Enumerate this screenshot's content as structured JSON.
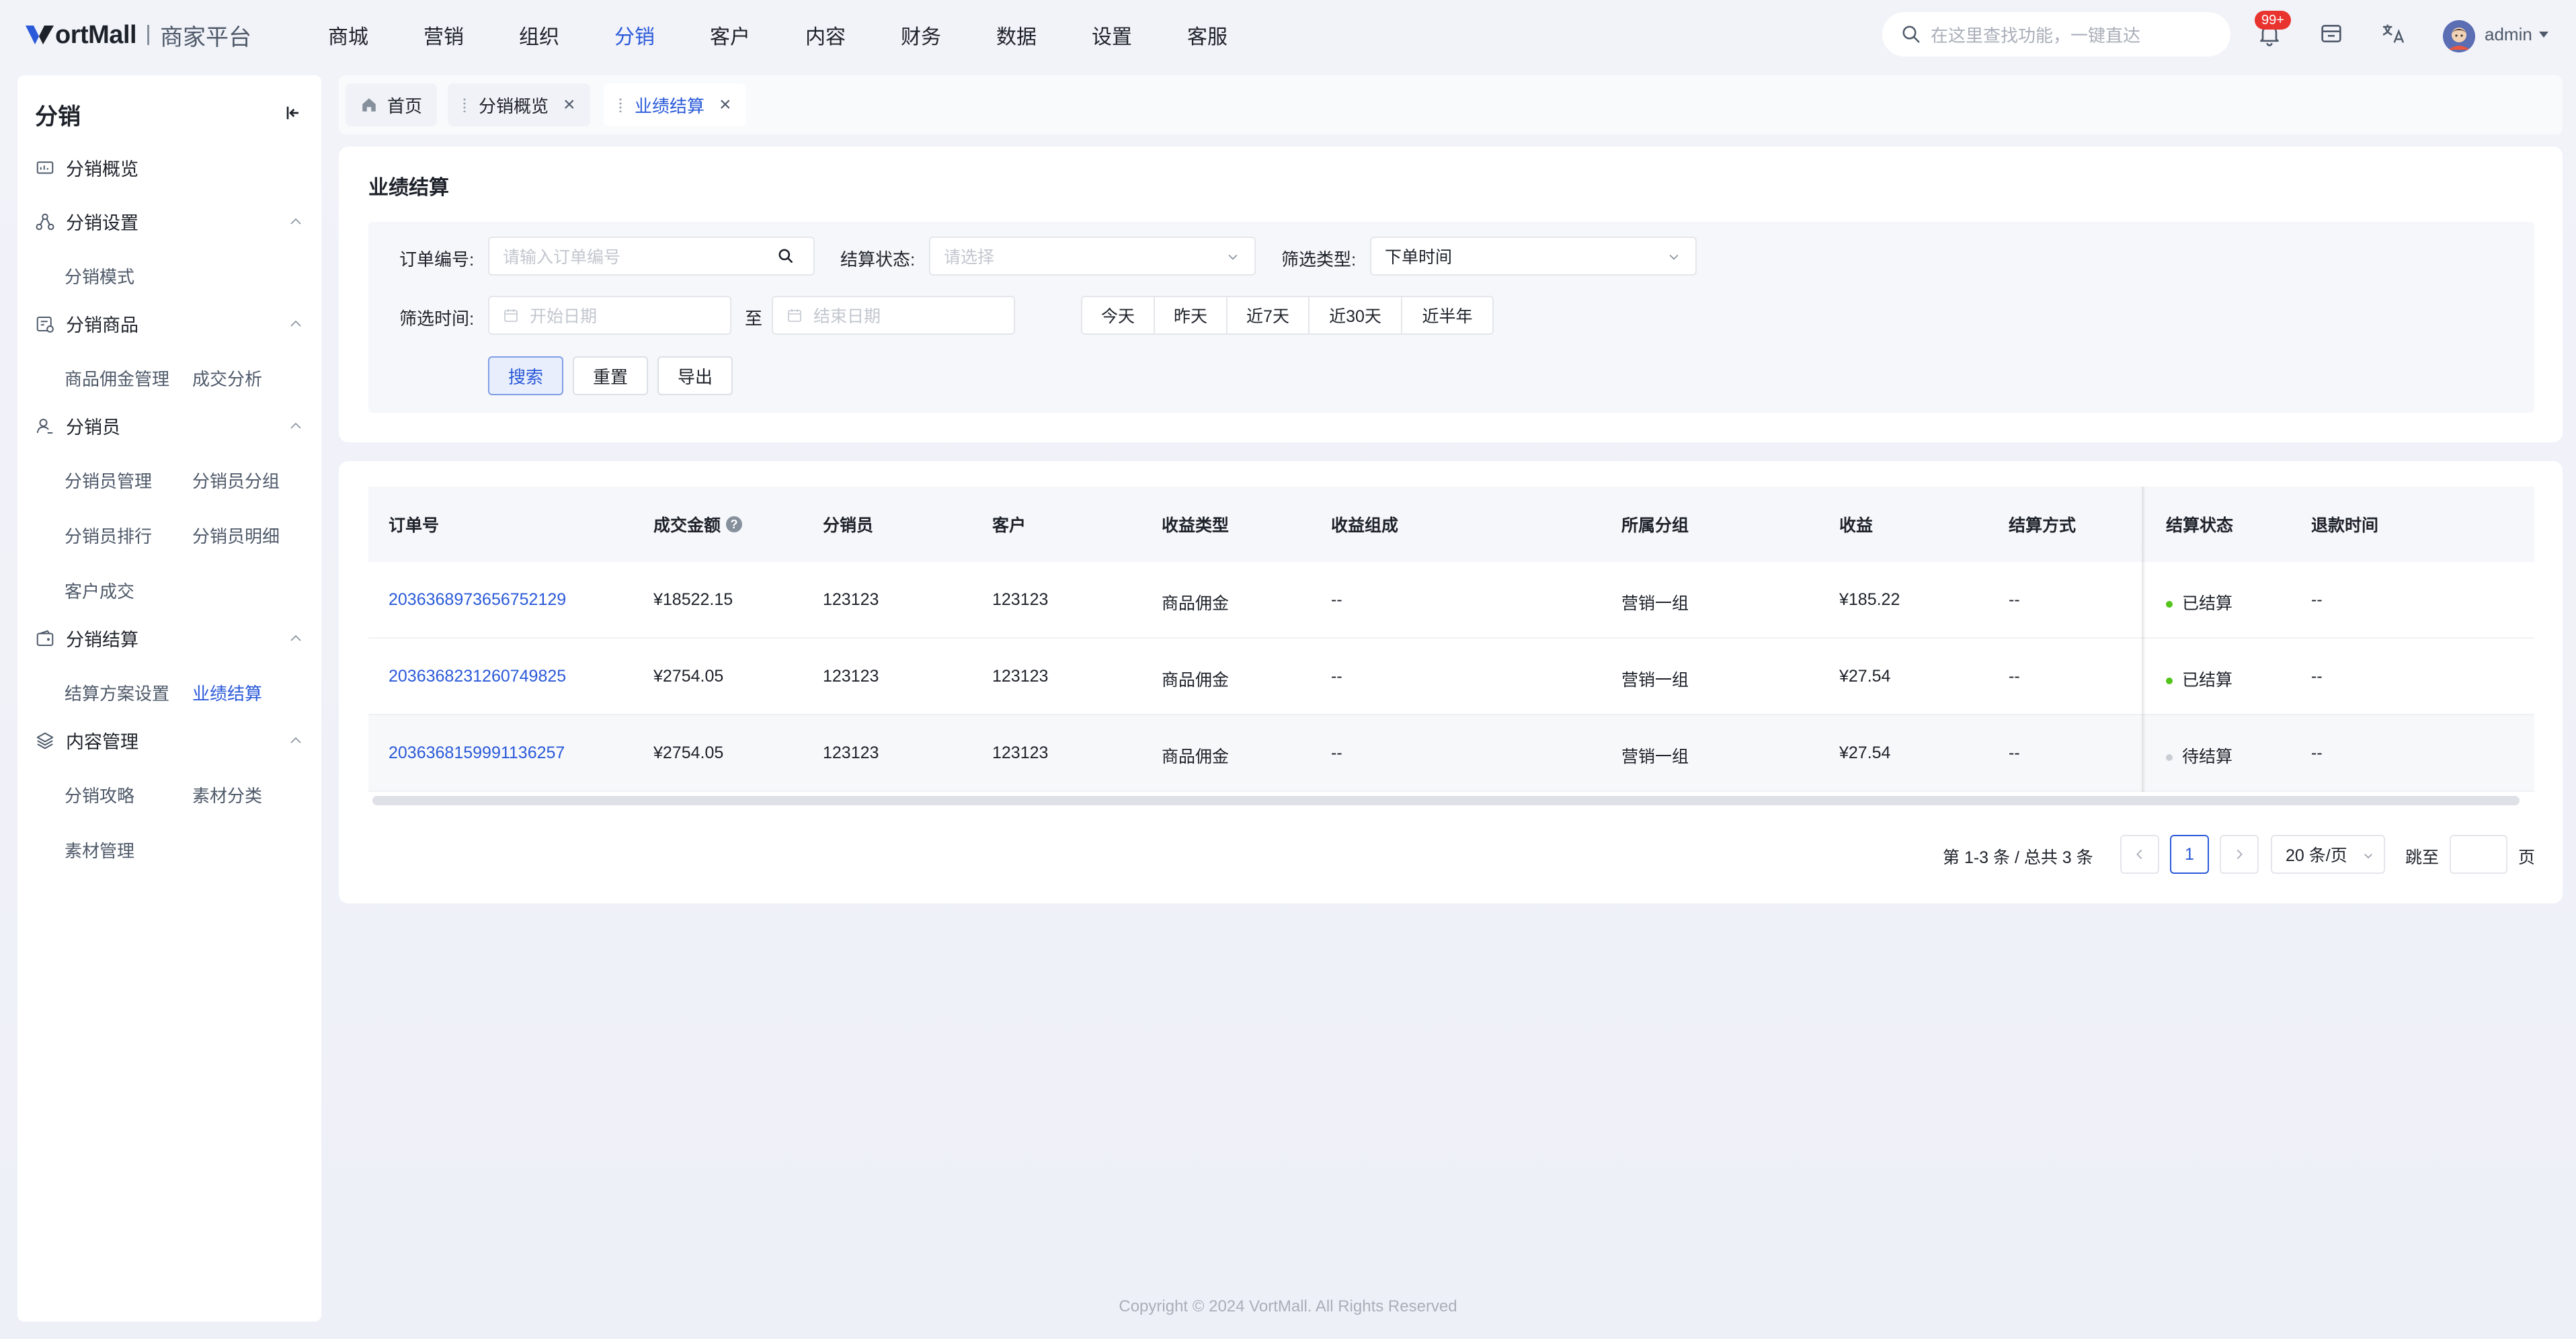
{
  "brand": {
    "logo_text": "ortMall",
    "sub": "商家平台"
  },
  "topnav": [
    {
      "label": "商城"
    },
    {
      "label": "营销"
    },
    {
      "label": "组织"
    },
    {
      "label": "分销",
      "active": true
    },
    {
      "label": "客户"
    },
    {
      "label": "内容"
    },
    {
      "label": "财务"
    },
    {
      "label": "数据"
    },
    {
      "label": "设置"
    },
    {
      "label": "客服"
    }
  ],
  "header": {
    "search_placeholder": "在这里查找功能，一键直达",
    "notification_badge": "99+",
    "user": "admin",
    "icons": [
      "bell-icon",
      "store-icon",
      "translate-icon"
    ]
  },
  "sidebar": {
    "title": "分销",
    "groups": [
      {
        "label": "分销概览",
        "icon": "dashboard-icon"
      },
      {
        "label": "分销设置",
        "icon": "network-icon",
        "items": [
          "分销模式"
        ]
      },
      {
        "label": "分销商品",
        "icon": "goods-icon",
        "items": [
          "商品佣金管理",
          "成交分析"
        ]
      },
      {
        "label": "分销员",
        "icon": "user-icon",
        "items": [
          "分销员管理",
          "分销员分组",
          "分销员排行",
          "分销员明细",
          "客户成交"
        ]
      },
      {
        "label": "分销结算",
        "icon": "wallet-icon",
        "items": [
          "结算方案设置",
          "业绩结算"
        ]
      },
      {
        "label": "内容管理",
        "icon": "layers-icon",
        "items": [
          "分销攻略",
          "素材分类",
          "素材管理"
        ]
      }
    ],
    "active_item": "业绩结算"
  },
  "tabs": [
    {
      "label": "首页",
      "icon": "home-icon"
    },
    {
      "label": "分销概览",
      "closable": true
    },
    {
      "label": "业绩结算",
      "closable": true,
      "active": true
    }
  ],
  "filter": {
    "title": "业绩结算",
    "order_label": "订单编号:",
    "order_placeholder": "请输入订单编号",
    "status_label": "结算状态:",
    "status_placeholder": "请选择",
    "type_label": "筛选类型:",
    "type_value": "下单时间",
    "time_label": "筛选时间:",
    "start_placeholder": "开始日期",
    "to": "至",
    "end_placeholder": "结束日期",
    "quick": [
      "今天",
      "昨天",
      "近7天",
      "近30天",
      "近半年"
    ],
    "buttons": {
      "search": "搜索",
      "reset": "重置",
      "export": "导出"
    }
  },
  "table": {
    "columns": [
      "订单号",
      "成交金额",
      "分销员",
      "客户",
      "收益类型",
      "收益组成",
      "所属分组",
      "收益",
      "结算方式",
      "结算状态",
      "退款时间"
    ],
    "rows": [
      {
        "order": "2036368973656752129",
        "amount": "¥18522.15",
        "distributor": "123123",
        "customer": "123123",
        "type": "商品佣金",
        "composition": "--",
        "group": "营销一组",
        "income": "¥185.22",
        "method": "--",
        "status": "已结算",
        "refund": "--"
      },
      {
        "order": "2036368231260749825",
        "amount": "¥2754.05",
        "distributor": "123123",
        "customer": "123123",
        "type": "商品佣金",
        "composition": "--",
        "group": "营销一组",
        "income": "¥27.54",
        "method": "--",
        "status": "已结算",
        "refund": "--"
      },
      {
        "order": "2036368159991136257",
        "amount": "¥2754.05",
        "distributor": "123123",
        "customer": "123123",
        "type": "商品佣金",
        "composition": "--",
        "group": "营销一组",
        "income": "¥27.54",
        "method": "--",
        "status": "待结算",
        "refund": "--"
      }
    ],
    "status_colors": {
      "已结算": "#52c41a",
      "待结算": "#c9cdd4"
    }
  },
  "pagination": {
    "summary": "第 1-3 条 / 总共 3 条",
    "current": "1",
    "page_size": "20 条/页",
    "jump_label": "跳至",
    "page_unit": "页"
  },
  "footer": "Copyright © 2024 VortMall. All Rights Reserved"
}
